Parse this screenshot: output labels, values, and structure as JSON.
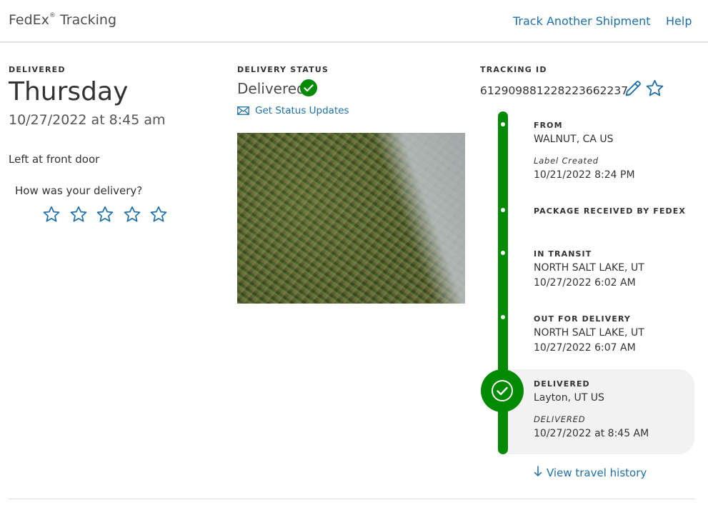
{
  "header": {
    "brand": "FedEx",
    "brand_mark": "®",
    "brand_suffix": "Tracking",
    "track_another": "Track Another Shipment",
    "help": "Help"
  },
  "summary": {
    "delivered_label": "DELIVERED",
    "day": "Thursday",
    "datetime": "10/27/2022 at 8:45 am",
    "location_note": "Left at front door",
    "rating_prompt": "How was your delivery?",
    "rating_stars": 5
  },
  "status": {
    "label": "DELIVERY STATUS",
    "value": "Delivered",
    "updates_link": "Get Status Updates",
    "photo_alt": ""
  },
  "tracking": {
    "label": "TRACKING ID",
    "id": "612909881228223662237",
    "edit_icon": "pencil-icon",
    "favorite_icon": "star-outline-icon"
  },
  "timeline": {
    "from": {
      "title": "FROM",
      "location": "WALNUT, CA US",
      "note": "Label Created",
      "time": "10/21/2022 8:24 PM"
    },
    "received": {
      "title": "PACKAGE RECEIVED BY FEDEX"
    },
    "transit": {
      "title": "IN TRANSIT",
      "location": "NORTH SALT LAKE, UT",
      "time": "10/27/2022 6:02 AM"
    },
    "out": {
      "title": "OUT FOR DELIVERY",
      "location": "NORTH SALT LAKE, UT",
      "time": "10/27/2022 6:07 AM"
    },
    "delivered": {
      "title": "DELIVERED",
      "location": "Layton, UT US",
      "note": "DELIVERED",
      "time": "10/27/2022 at 8:45 AM"
    }
  },
  "history_link": "View travel history",
  "colors": {
    "accent_green": "#008a00",
    "link_blue": "#1f6fa8"
  }
}
